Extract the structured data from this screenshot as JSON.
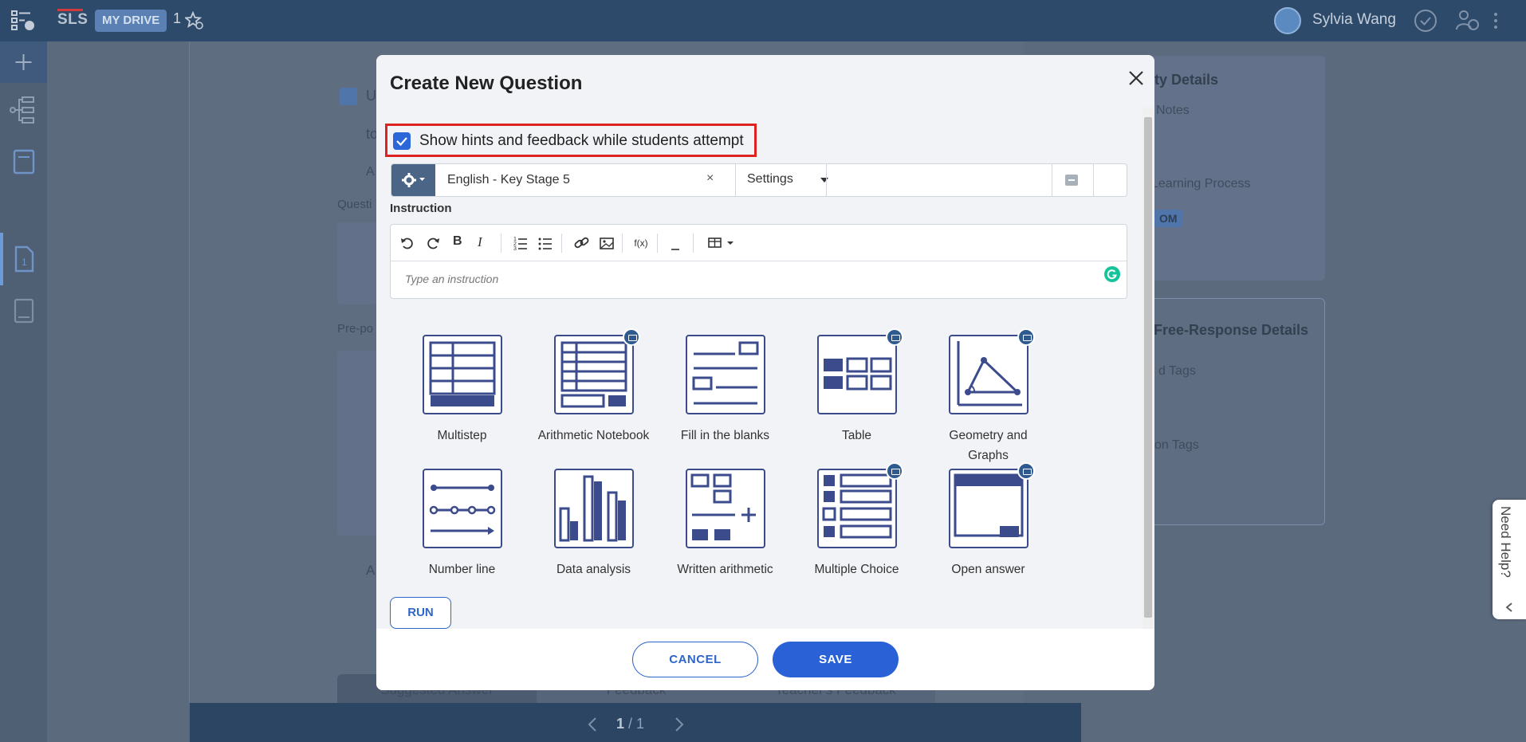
{
  "topbar": {
    "logo": "SLS",
    "drive_label": "MY DRIVE",
    "drive_count": "1",
    "user_name": "Sylvia Wang"
  },
  "background": {
    "right_card_title": "ty Details",
    "right_card_notes": "Notes",
    "right_card_process": "Learning Process",
    "right_card_badge": "OM",
    "right_card2_title": "Free-Response Details",
    "right_card2_tags1": "d Tags",
    "right_card2_tags2": "on Tags",
    "left_fragment_1": "U",
    "left_fragment_2": "to",
    "left_fragment_3": "A",
    "left_question_label": "Questi",
    "left_prepost_label": "Pre-po",
    "left_fragment_4": "A",
    "tab_suggested": "Suggested Answer",
    "tab_feedback": "Feedback",
    "tab_teacher": "Teacher's Feedback",
    "pager_current": "1",
    "pager_total": "/ 1",
    "need_help": "Need Help?"
  },
  "modal": {
    "title": "Create New Question",
    "hint_label": "Show hints and feedback while students attempt",
    "tag_language": "English - Key Stage 5",
    "tag_clear": "×",
    "settings_label": "Settings",
    "instruction_label": "Instruction",
    "instruction_placeholder": "Type an instruction",
    "toolbar_fx": "f(x)",
    "question_types": [
      {
        "label": "Multistep"
      },
      {
        "label": "Arithmetic Notebook"
      },
      {
        "label": "Fill in the blanks"
      },
      {
        "label": "Table"
      },
      {
        "label": "Geometry and Graphs"
      },
      {
        "label": "Number line"
      },
      {
        "label": "Data analysis"
      },
      {
        "label": "Written arithmetic"
      },
      {
        "label": "Multiple Choice"
      },
      {
        "label": "Open answer"
      }
    ],
    "run_label": "RUN",
    "cancel_label": "CANCEL",
    "save_label": "SAVE"
  }
}
